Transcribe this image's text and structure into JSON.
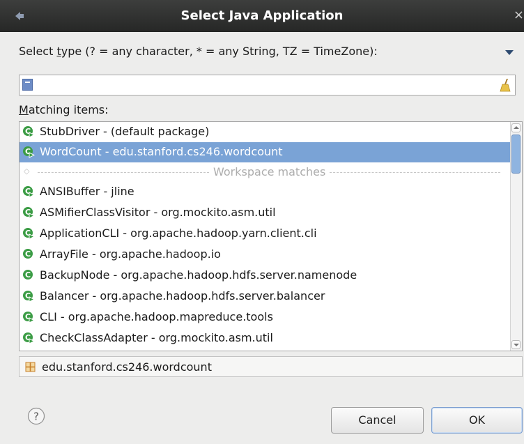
{
  "window": {
    "title": "Select Java Application",
    "close_glyph": "×"
  },
  "search": {
    "label_before": "Select ",
    "label_mnemonic": "t",
    "label_after": "ype (? = any character, * = any String, TZ = TimeZone):",
    "value": ""
  },
  "matching": {
    "label_mnemonic": "M",
    "label_rest": "atching items:"
  },
  "list": {
    "items": [
      {
        "label": "StubDriver - (default package)",
        "icon": "class-run-icon",
        "selected": false
      },
      {
        "label": "WordCount - edu.stanford.cs246.wordcount",
        "icon": "class-run-icon",
        "selected": true
      }
    ],
    "separator_label": "Workspace matches",
    "workspace_items": [
      {
        "label": "ANSIBuffer - jline",
        "icon": "class-run-icon"
      },
      {
        "label": "ASMifierClassVisitor - org.mockito.asm.util",
        "icon": "class-run-icon"
      },
      {
        "label": "ApplicationCLI - org.apache.hadoop.yarn.client.cli",
        "icon": "class-run-icon"
      },
      {
        "label": "ArrayFile - org.apache.hadoop.io",
        "icon": "class-icon"
      },
      {
        "label": "BackupNode - org.apache.hadoop.hdfs.server.namenode",
        "icon": "class-icon"
      },
      {
        "label": "Balancer - org.apache.hadoop.hdfs.server.balancer",
        "icon": "class-run-icon"
      },
      {
        "label": "CLI - org.apache.hadoop.mapreduce.tools",
        "icon": "class-run-icon"
      },
      {
        "label": "CheckClassAdapter - org.mockito.asm.util",
        "icon": "class-run-icon"
      }
    ]
  },
  "status": {
    "package": "edu.stanford.cs246.wordcount"
  },
  "buttons": {
    "help_glyph": "?",
    "cancel": "Cancel",
    "ok": "OK"
  },
  "colors": {
    "titlebar": "#2e2f2e",
    "selection": "#7aa3d6",
    "class_icon": "#3b9c45"
  }
}
